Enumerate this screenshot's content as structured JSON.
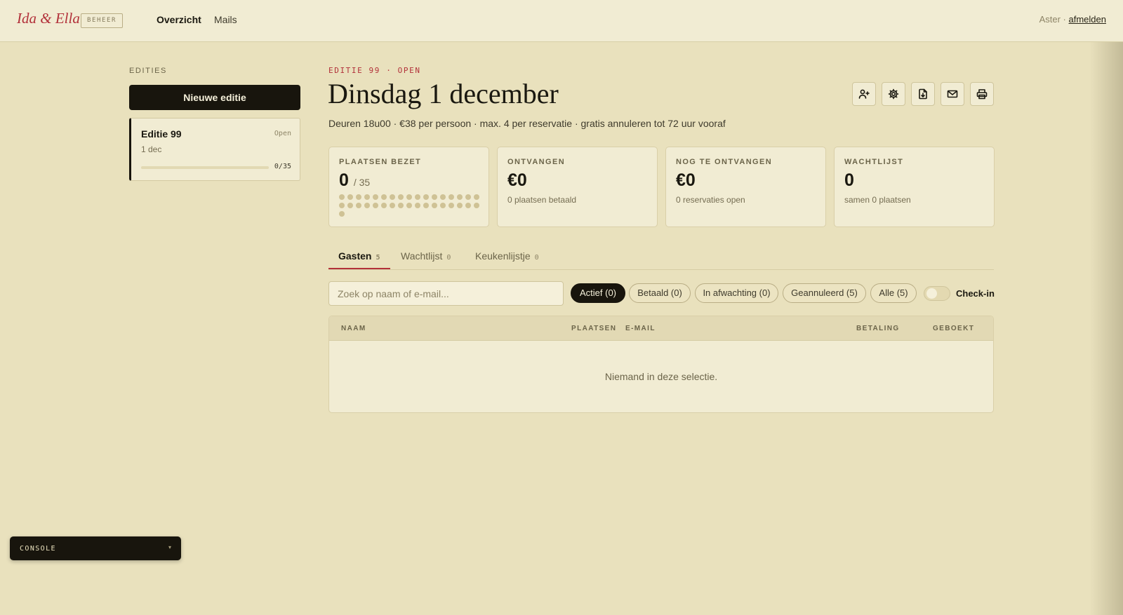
{
  "header": {
    "logo": "Ida & Ella",
    "badge": "BEHEER",
    "nav": [
      {
        "label": "Overzicht",
        "active": true
      },
      {
        "label": "Mails",
        "active": false
      }
    ],
    "user_name": "Aster ·",
    "logout_label": "afmelden"
  },
  "sidebar": {
    "section_label": "EDITIES",
    "new_button": "Nieuwe editie",
    "editions": [
      {
        "title": "Editie 99",
        "status": "Open",
        "date": "1 dec",
        "booked": 0,
        "capacity": 35,
        "count_label": "0/35"
      }
    ]
  },
  "main": {
    "eyebrow": "EDITIE 99 · OPEN",
    "title": "Dinsdag 1 december",
    "subline": "Deuren 18u00 · €38 per persoon · max. 4 per reservatie · gratis annuleren tot 72 uur vooraf",
    "actions": [
      {
        "icon": "add-user-icon"
      },
      {
        "icon": "gear-icon"
      },
      {
        "icon": "download-file-icon"
      },
      {
        "icon": "mail-icon"
      },
      {
        "icon": "printer-icon"
      }
    ],
    "stats": [
      {
        "label": "PLAATSEN BEZET",
        "value": "0",
        "denominator": "/ 35",
        "seats_total": 35,
        "seats_taken": 0
      },
      {
        "label": "ONTVANGEN",
        "value": "€0",
        "sub": "0 plaatsen betaald"
      },
      {
        "label": "NOG TE ONTVANGEN",
        "value": "€0",
        "sub": "0 reservaties open"
      },
      {
        "label": "WACHTLIJST",
        "value": "0",
        "sub": "samen 0 plaatsen"
      }
    ],
    "tabs": [
      {
        "label": "Gasten",
        "count": "5",
        "active": true
      },
      {
        "label": "Wachtlijst",
        "count": "0",
        "active": false
      },
      {
        "label": "Keukenlijstje",
        "count": "0",
        "active": false
      }
    ],
    "search": {
      "placeholder": "Zoek op naam of e-mail...",
      "value": ""
    },
    "filters": [
      {
        "label": "Actief (0)",
        "active": true
      },
      {
        "label": "Betaald (0)",
        "active": false
      },
      {
        "label": "In afwachting (0)",
        "active": false
      },
      {
        "label": "Geannuleerd (5)",
        "active": false
      },
      {
        "label": "Alle (5)",
        "active": false
      }
    ],
    "checkin": {
      "label": "Check-in",
      "on": false
    },
    "table": {
      "columns": [
        "NAAM",
        "PLAATSEN",
        "E-MAIL",
        "BETALING",
        "GEBOEKT"
      ],
      "rows": [],
      "empty_message": "Niemand in deze selectie."
    }
  },
  "console": {
    "label": "CONSOLE",
    "caret": "▾"
  },
  "colors": {
    "accent": "#b2313a",
    "background": "#e9e1bd",
    "panel": "#f1ecd3",
    "ink": "#18150d"
  }
}
